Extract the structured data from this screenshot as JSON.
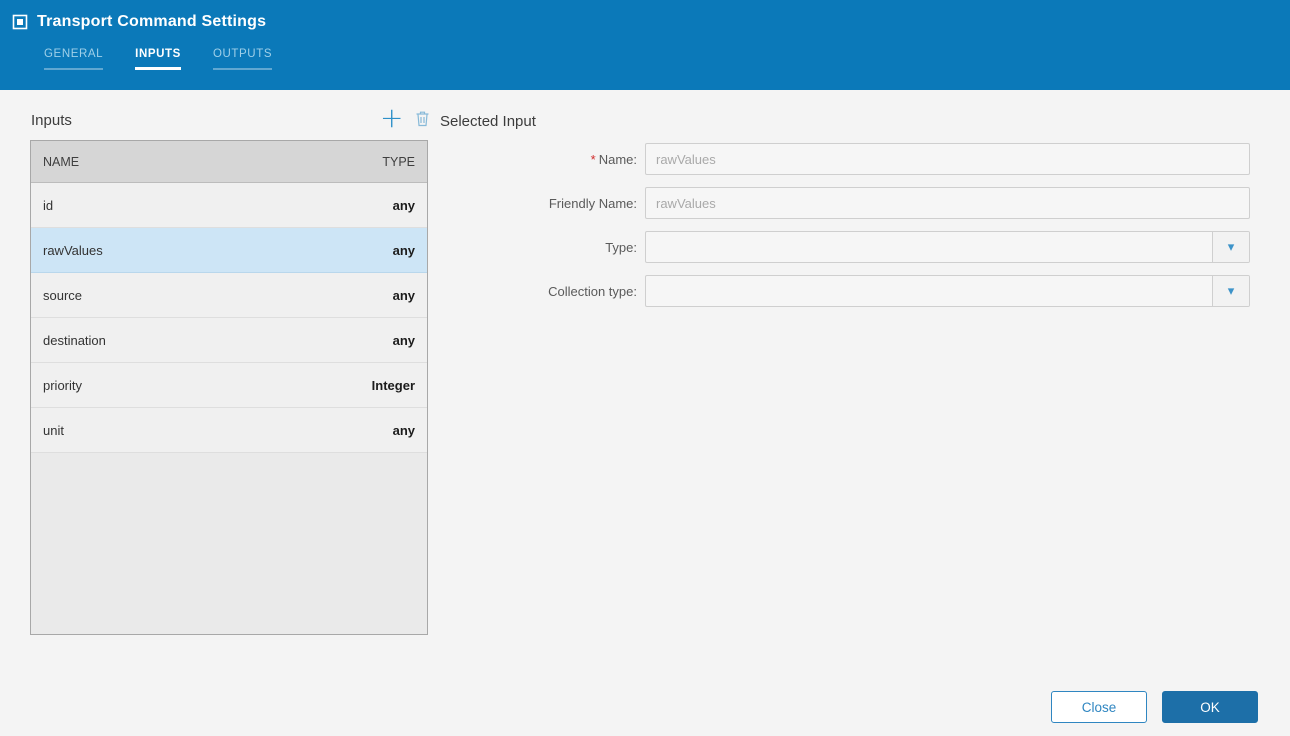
{
  "header": {
    "title": "Transport Command Settings",
    "tabs": [
      {
        "label": "GENERAL",
        "active": false
      },
      {
        "label": "INPUTS",
        "active": true
      },
      {
        "label": "OUTPUTS",
        "active": false
      }
    ]
  },
  "inputs_panel": {
    "title": "Inputs",
    "columns": {
      "name": "NAME",
      "type": "TYPE"
    },
    "rows": [
      {
        "name": "id",
        "type": "any",
        "selected": false
      },
      {
        "name": "rawValues",
        "type": "any",
        "selected": true
      },
      {
        "name": "source",
        "type": "any",
        "selected": false
      },
      {
        "name": "destination",
        "type": "any",
        "selected": false
      },
      {
        "name": "priority",
        "type": "Integer",
        "selected": false
      },
      {
        "name": "unit",
        "type": "any",
        "selected": false
      }
    ]
  },
  "selected_input": {
    "title": "Selected Input",
    "required_marker": "*",
    "fields": [
      {
        "label": "Name:",
        "required": true,
        "value": "rawValues",
        "control": "text"
      },
      {
        "label": "Friendly Name:",
        "required": false,
        "value": "rawValues",
        "control": "text"
      },
      {
        "label": "Type:",
        "required": false,
        "value": "",
        "control": "select"
      },
      {
        "label": "Collection type:",
        "required": false,
        "value": "",
        "control": "select"
      }
    ],
    "select_caret": "▾"
  },
  "footer": {
    "close_label": "Close",
    "ok_label": "OK"
  },
  "colors": {
    "header_blue": "#0b79b9",
    "selected_row": "#cde5f6",
    "ok_blue": "#1d6fa8",
    "accent_blue": "#2e90c8"
  }
}
